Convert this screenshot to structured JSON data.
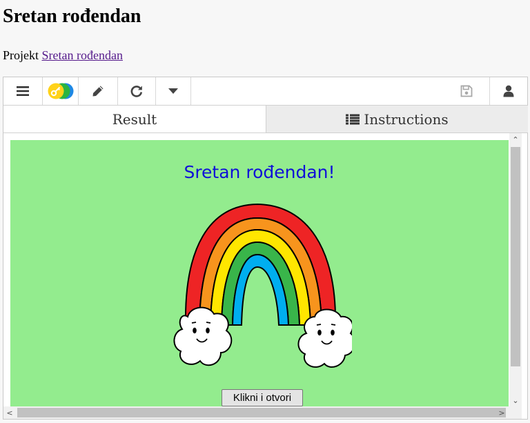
{
  "page": {
    "title": "Sretan rođendan",
    "project_prefix": "Projekt",
    "project_link": "Sretan rođendan"
  },
  "toolbar": {
    "icons": [
      "menu-icon",
      "key-icon",
      "pencil-icon",
      "refresh-icon",
      "caret-down-icon",
      "save-icon",
      "user-icon"
    ]
  },
  "tabs": {
    "result": "Result",
    "instructions": "Instructions"
  },
  "stage": {
    "greeting": "Sretan rođendan!",
    "open_button": "Klikni i otvori",
    "background_color": "#93ec8e",
    "greeting_color": "#1010d8"
  },
  "scrollbars": {
    "up": "⌃",
    "down": "⌄",
    "left": "<",
    "right": ">"
  }
}
